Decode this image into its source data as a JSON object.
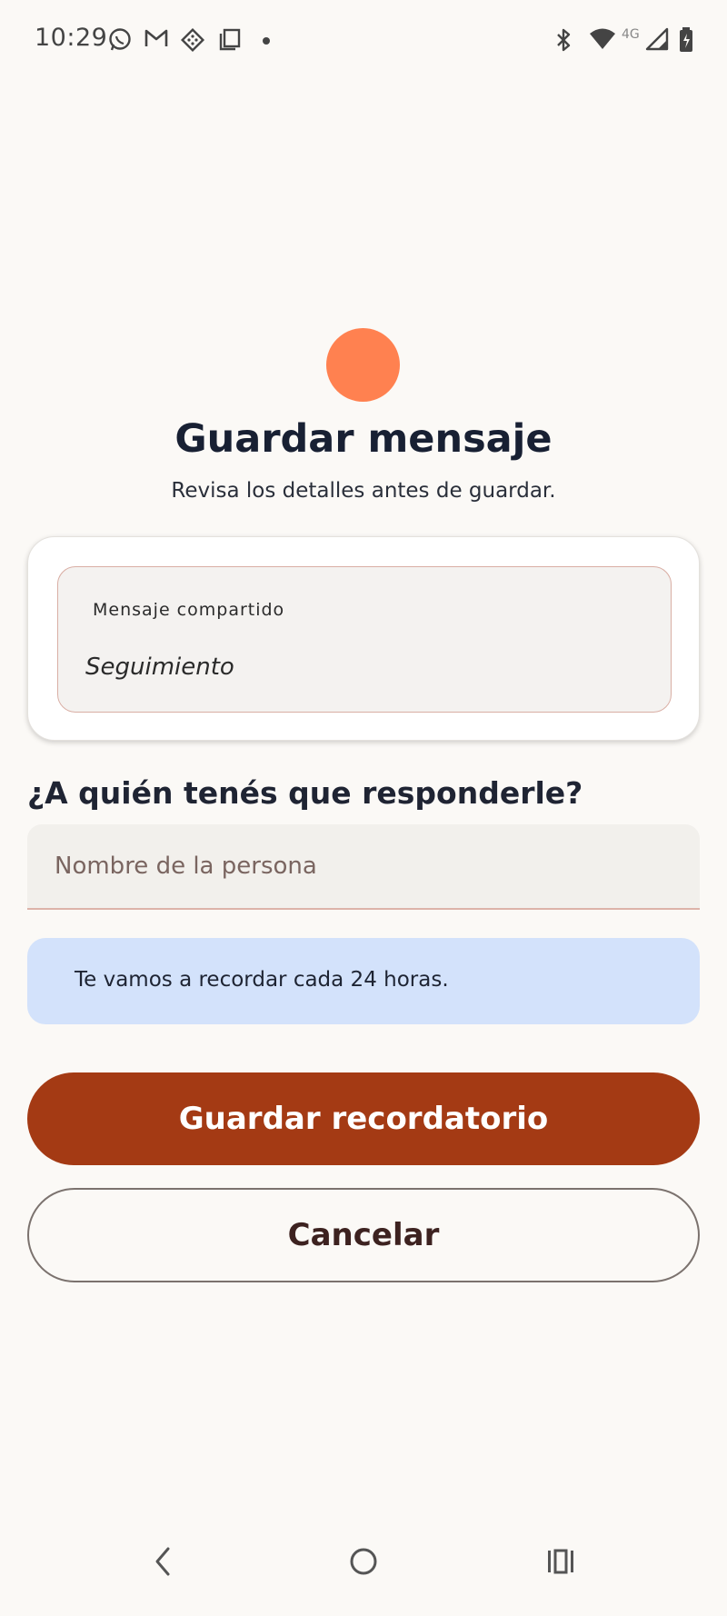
{
  "status_bar": {
    "time": "10:29",
    "left_icons": [
      "whatsapp-icon",
      "gmail-icon",
      "app-icon",
      "screenshot-icon",
      "notification-dot-icon"
    ],
    "right_icons": [
      "bluetooth-icon",
      "wifi-icon",
      "4g-icon",
      "signal-icon",
      "battery-icon"
    ],
    "network_label": "4G"
  },
  "header": {
    "title": "Guardar mensaje",
    "subtitle": "Revisa los detalles antes de guardar."
  },
  "shared_message": {
    "label": "Mensaje compartido",
    "value": "Seguimiento"
  },
  "recipient": {
    "question": "¿A quién tenés que responderle?",
    "placeholder": "Nombre de la persona",
    "value": ""
  },
  "info": {
    "text": "Te vamos a recordar cada 24 horas."
  },
  "actions": {
    "save_label": "Guardar recordatorio",
    "cancel_label": "Cancelar"
  },
  "colors": {
    "accent": "#ff8150",
    "primary_button": "#a43a14",
    "info_background": "#d3e2fb",
    "background": "#fbf9f6"
  },
  "nav_bar": {
    "icons": [
      "back-icon",
      "home-icon",
      "recents-icon"
    ]
  }
}
